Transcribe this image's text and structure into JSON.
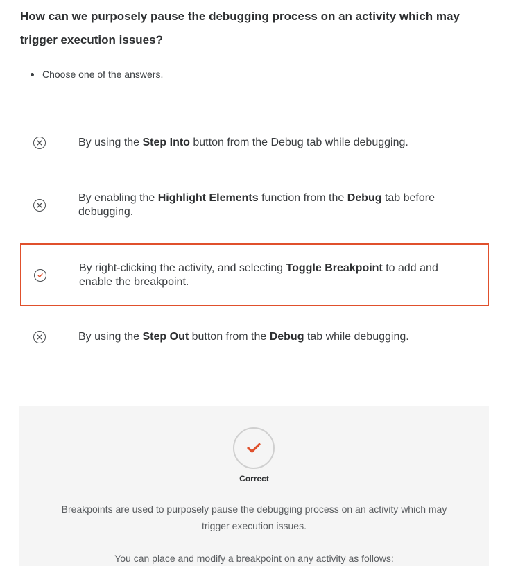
{
  "question": {
    "text": "How can we purposely pause the debugging process on an activity which may trigger execution issues?"
  },
  "instructions": [
    "Choose one of the answers."
  ],
  "answers": [
    {
      "state": "incorrect",
      "icon": "x-circle-icon",
      "parts": [
        {
          "t": "By using the "
        },
        {
          "b": "Step Into"
        },
        {
          "t": " button from the Debug tab while debugging."
        }
      ]
    },
    {
      "state": "incorrect",
      "icon": "x-circle-icon",
      "parts": [
        {
          "t": "By enabling the "
        },
        {
          "b": "Highlight Elements"
        },
        {
          "t": " function from the "
        },
        {
          "b": "Debug"
        },
        {
          "t": " tab before debugging."
        }
      ]
    },
    {
      "state": "selected-correct",
      "icon": "check-circle-icon",
      "parts": [
        {
          "t": "By right-clicking the activity, and selecting "
        },
        {
          "b": "Toggle Breakpoint"
        },
        {
          "t": " to add and enable the breakpoint."
        }
      ]
    },
    {
      "state": "incorrect",
      "icon": "x-circle-icon",
      "parts": [
        {
          "t": "By using the "
        },
        {
          "b": "Step Out"
        },
        {
          "t": " button from the "
        },
        {
          "b": "Debug"
        },
        {
          "t": " tab while debugging."
        }
      ]
    }
  ],
  "feedback": {
    "icon": "checkmark-icon",
    "status": "Correct",
    "explanation_1": "Breakpoints are used to purposely pause the debugging process on an activity which may trigger execution issues.",
    "explanation_2": "You can place and modify a breakpoint on any activity as follows:"
  },
  "colors": {
    "accent": "#e0502c",
    "feedback_bg": "#f5f5f5",
    "text": "#3a3d40"
  }
}
